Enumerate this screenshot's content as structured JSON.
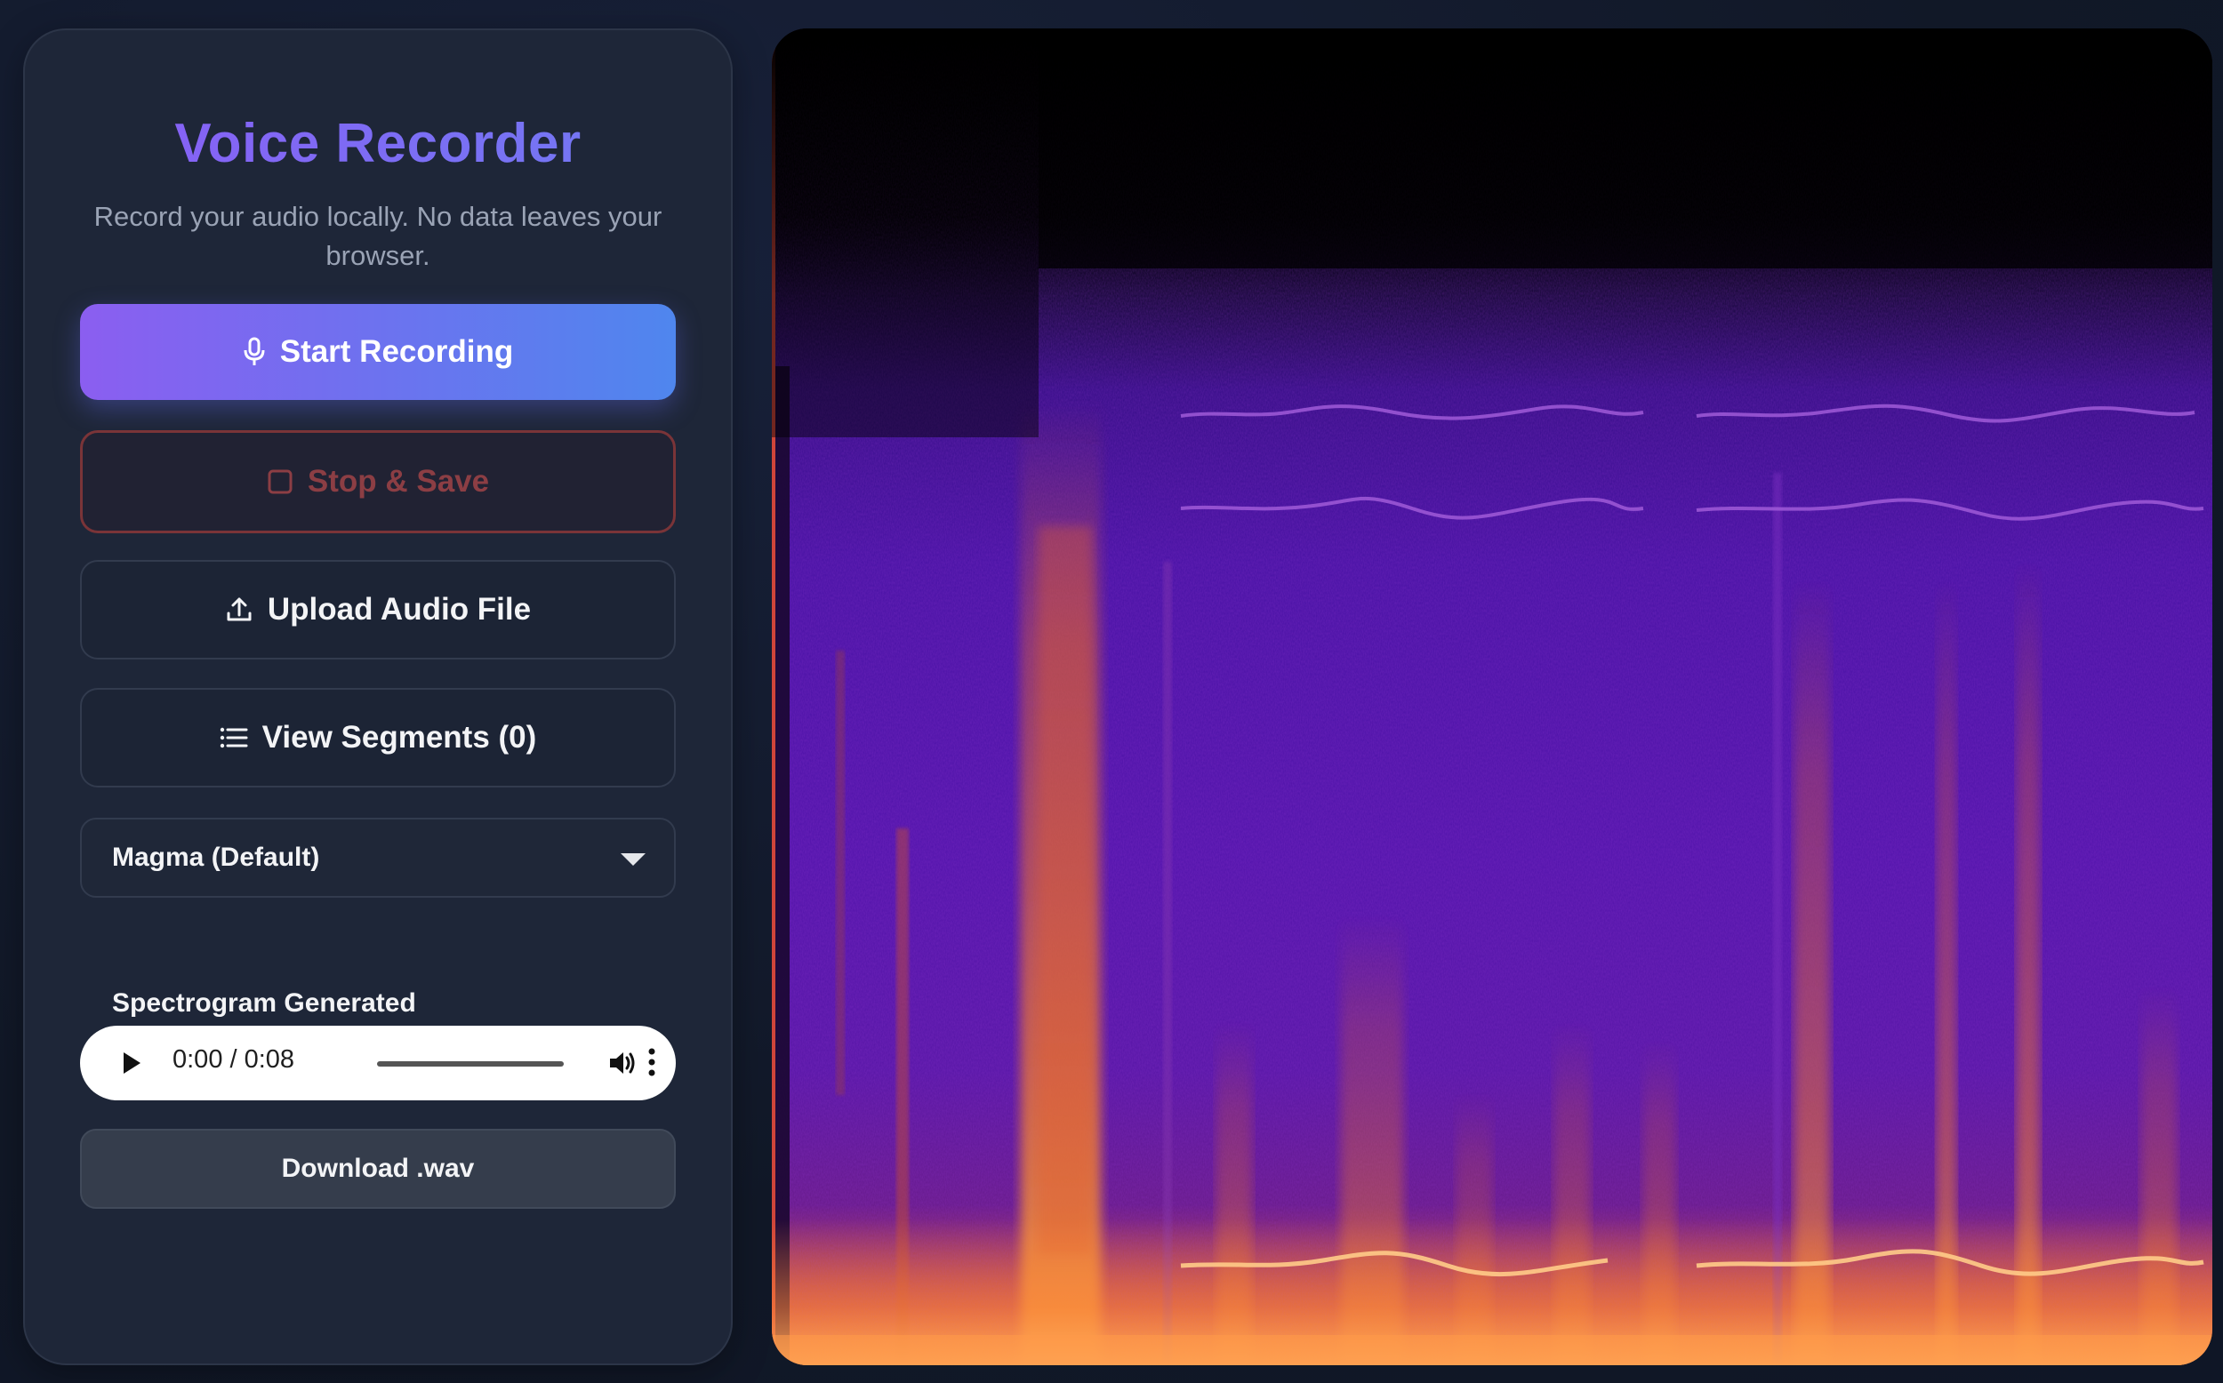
{
  "app": {
    "title": "Voice Recorder",
    "subtitle": "Record your audio locally. No data leaves your browser."
  },
  "buttons": {
    "start_label": "Start Recording",
    "stop_label": "Stop & Save",
    "upload_label": "Upload Audio File",
    "segments_label": "View Segments (0)",
    "download_label": "Download .wav"
  },
  "colormap": {
    "selected": "Magma (Default)"
  },
  "status": {
    "text": "Spectrogram Generated"
  },
  "player": {
    "time": "0:00 / 0:08",
    "current": "0:00",
    "duration": "0:08",
    "progress": 0
  },
  "colors": {
    "accent_start": "#8b5ef0",
    "accent_end": "#4f86ee",
    "stop_red": "#7a3438",
    "panel_bg": "#1e2638",
    "page_bg": "#111827"
  },
  "icons": {
    "start": "microphone-icon",
    "stop": "stop-square-icon",
    "upload": "upload-icon",
    "segments": "list-icon",
    "select": "caret-down-icon",
    "play": "play-icon",
    "volume": "volume-icon",
    "more": "more-vertical-icon"
  },
  "spectrogram": {
    "colormap": "magma"
  }
}
